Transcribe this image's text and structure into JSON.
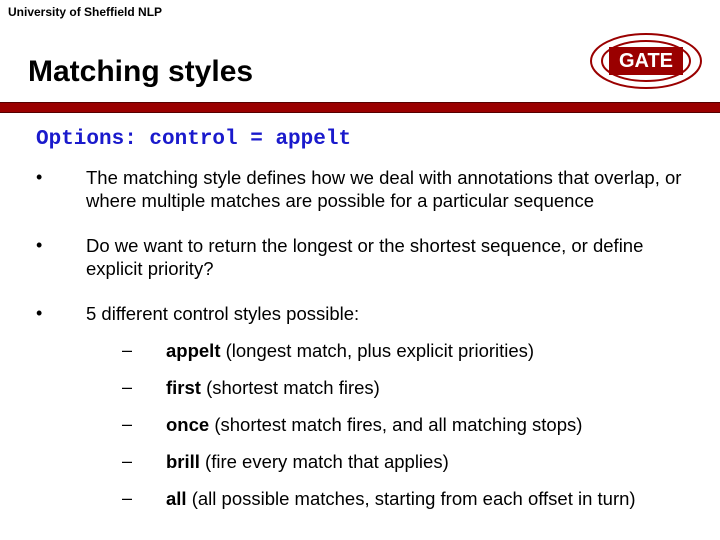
{
  "affiliation": "University of Sheffield NLP",
  "logo_text": "GATE",
  "title": "Matching styles",
  "subtitle": "Options: control = appelt",
  "bullets": [
    "The matching style defines how we deal with annotations that overlap, or where multiple matches are possible for a particular sequence",
    "Do we want to return the longest or the shortest sequence, or define explicit priority?",
    "5 different control styles possible:"
  ],
  "styles": [
    {
      "name": "appelt",
      "desc": " (longest match, plus explicit priorities)"
    },
    {
      "name": "first",
      "desc": " (shortest match fires)"
    },
    {
      "name": "once",
      "desc": " (shortest match fires, and all matching stops)"
    },
    {
      "name": "brill",
      "desc": " (fire every match that applies)"
    },
    {
      "name": "all",
      "desc": " (all possible matches, starting from each offset in turn)"
    }
  ]
}
